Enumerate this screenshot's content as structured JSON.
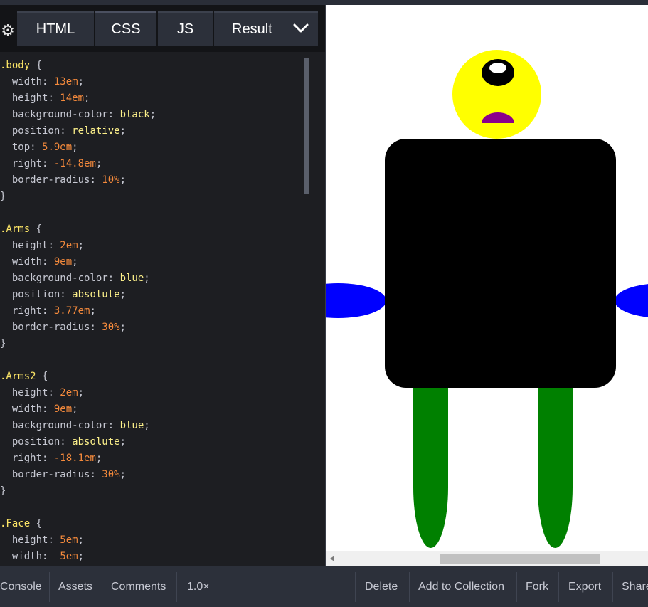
{
  "tabs": {
    "html": "HTML",
    "css": "CSS",
    "js": "JS",
    "result": "Result"
  },
  "code_lines": [
    [
      {
        "t": ".body",
        "c": "sel"
      },
      {
        "t": " {",
        "c": "punc"
      }
    ],
    [
      {
        "t": "  width",
        "c": "prop"
      },
      {
        "t": ": ",
        "c": "punc"
      },
      {
        "t": "13em",
        "c": "num"
      },
      {
        "t": ";",
        "c": "punc"
      }
    ],
    [
      {
        "t": "  height",
        "c": "prop"
      },
      {
        "t": ": ",
        "c": "punc"
      },
      {
        "t": "14em",
        "c": "num"
      },
      {
        "t": ";",
        "c": "punc"
      }
    ],
    [
      {
        "t": "  background-color",
        "c": "prop"
      },
      {
        "t": ": ",
        "c": "punc"
      },
      {
        "t": "black",
        "c": "kw"
      },
      {
        "t": ";",
        "c": "punc"
      }
    ],
    [
      {
        "t": "  position",
        "c": "prop"
      },
      {
        "t": ": ",
        "c": "punc"
      },
      {
        "t": "relative",
        "c": "kw"
      },
      {
        "t": ";",
        "c": "punc"
      }
    ],
    [
      {
        "t": "  top",
        "c": "prop"
      },
      {
        "t": ": ",
        "c": "punc"
      },
      {
        "t": "5.9em",
        "c": "num"
      },
      {
        "t": ";",
        "c": "punc"
      }
    ],
    [
      {
        "t": "  right",
        "c": "prop"
      },
      {
        "t": ": ",
        "c": "punc"
      },
      {
        "t": "-14.8em",
        "c": "num"
      },
      {
        "t": ";",
        "c": "punc"
      }
    ],
    [
      {
        "t": "  border-radius",
        "c": "prop"
      },
      {
        "t": ": ",
        "c": "punc"
      },
      {
        "t": "10%",
        "c": "num"
      },
      {
        "t": ";",
        "c": "punc"
      }
    ],
    [
      {
        "t": "}",
        "c": "punc"
      }
    ],
    [
      {
        "t": "",
        "c": "punc"
      }
    ],
    [
      {
        "t": ".Arms",
        "c": "sel"
      },
      {
        "t": " {",
        "c": "punc"
      }
    ],
    [
      {
        "t": "  height",
        "c": "prop"
      },
      {
        "t": ": ",
        "c": "punc"
      },
      {
        "t": "2em",
        "c": "num"
      },
      {
        "t": ";",
        "c": "punc"
      }
    ],
    [
      {
        "t": "  width",
        "c": "prop"
      },
      {
        "t": ": ",
        "c": "punc"
      },
      {
        "t": "9em",
        "c": "num"
      },
      {
        "t": ";",
        "c": "punc"
      }
    ],
    [
      {
        "t": "  background-color",
        "c": "prop"
      },
      {
        "t": ": ",
        "c": "punc"
      },
      {
        "t": "blue",
        "c": "kw"
      },
      {
        "t": ";",
        "c": "punc"
      }
    ],
    [
      {
        "t": "  position",
        "c": "prop"
      },
      {
        "t": ": ",
        "c": "punc"
      },
      {
        "t": "absolute",
        "c": "kw"
      },
      {
        "t": ";",
        "c": "punc"
      }
    ],
    [
      {
        "t": "  right",
        "c": "prop"
      },
      {
        "t": ": ",
        "c": "punc"
      },
      {
        "t": "3.77em",
        "c": "num"
      },
      {
        "t": ";",
        "c": "punc"
      }
    ],
    [
      {
        "t": "  border-radius",
        "c": "prop"
      },
      {
        "t": ": ",
        "c": "punc"
      },
      {
        "t": "30%",
        "c": "num"
      },
      {
        "t": ";",
        "c": "punc"
      }
    ],
    [
      {
        "t": "}",
        "c": "punc"
      }
    ],
    [
      {
        "t": "",
        "c": "punc"
      }
    ],
    [
      {
        "t": ".Arms2",
        "c": "sel"
      },
      {
        "t": " {",
        "c": "punc"
      }
    ],
    [
      {
        "t": "  height",
        "c": "prop"
      },
      {
        "t": ": ",
        "c": "punc"
      },
      {
        "t": "2em",
        "c": "num"
      },
      {
        "t": ";",
        "c": "punc"
      }
    ],
    [
      {
        "t": "  width",
        "c": "prop"
      },
      {
        "t": ": ",
        "c": "punc"
      },
      {
        "t": "9em",
        "c": "num"
      },
      {
        "t": ";",
        "c": "punc"
      }
    ],
    [
      {
        "t": "  background-color",
        "c": "prop"
      },
      {
        "t": ": ",
        "c": "punc"
      },
      {
        "t": "blue",
        "c": "kw"
      },
      {
        "t": ";",
        "c": "punc"
      }
    ],
    [
      {
        "t": "  position",
        "c": "prop"
      },
      {
        "t": ": ",
        "c": "punc"
      },
      {
        "t": "absolute",
        "c": "kw"
      },
      {
        "t": ";",
        "c": "punc"
      }
    ],
    [
      {
        "t": "  right",
        "c": "prop"
      },
      {
        "t": ": ",
        "c": "punc"
      },
      {
        "t": "-18.1em",
        "c": "num"
      },
      {
        "t": ";",
        "c": "punc"
      }
    ],
    [
      {
        "t": "  border-radius",
        "c": "prop"
      },
      {
        "t": ": ",
        "c": "punc"
      },
      {
        "t": "30%",
        "c": "num"
      },
      {
        "t": ";",
        "c": "punc"
      }
    ],
    [
      {
        "t": "}",
        "c": "punc"
      }
    ],
    [
      {
        "t": "",
        "c": "punc"
      }
    ],
    [
      {
        "t": ".Face",
        "c": "sel"
      },
      {
        "t": " {",
        "c": "punc"
      }
    ],
    [
      {
        "t": "  height",
        "c": "prop"
      },
      {
        "t": ": ",
        "c": "punc"
      },
      {
        "t": "5em",
        "c": "num"
      },
      {
        "t": ";",
        "c": "punc"
      }
    ],
    [
      {
        "t": "  width",
        "c": "prop"
      },
      {
        "t": ":  ",
        "c": "punc"
      },
      {
        "t": "5em",
        "c": "num"
      },
      {
        "t": ";",
        "c": "punc"
      }
    ]
  ],
  "footer": {
    "console": "Console",
    "assets": "Assets",
    "comments": "Comments",
    "zoom": "1.0×",
    "delete": "Delete",
    "add_to_collection": "Add to Collection",
    "fork": "Fork",
    "export": "Export",
    "share": "Share"
  },
  "colors": {
    "head": "#ffff00",
    "torso": "#000000",
    "arms": "#0000ff",
    "legs": "#008000",
    "mouth": "#8b008b"
  },
  "icons": {
    "settings": "gear-icon",
    "result_menu": "chevron-down-icon",
    "scroll_left": "arrow-left-icon"
  }
}
